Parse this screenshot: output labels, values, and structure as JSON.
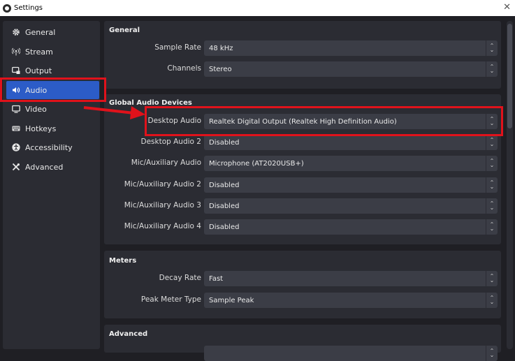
{
  "window": {
    "title": "Settings",
    "close_glyph": "✕"
  },
  "sidebar": {
    "items": [
      {
        "label": "General",
        "icon": "gear-icon"
      },
      {
        "label": "Stream",
        "icon": "broadcast-icon"
      },
      {
        "label": "Output",
        "icon": "output-icon"
      },
      {
        "label": "Audio",
        "icon": "speaker-icon",
        "active": true
      },
      {
        "label": "Video",
        "icon": "monitor-icon"
      },
      {
        "label": "Hotkeys",
        "icon": "keyboard-icon"
      },
      {
        "label": "Accessibility",
        "icon": "accessibility-icon"
      },
      {
        "label": "Advanced",
        "icon": "tools-icon"
      }
    ]
  },
  "general": {
    "title": "General",
    "sample_rate": {
      "label": "Sample Rate",
      "value": "48 kHz"
    },
    "channels": {
      "label": "Channels",
      "value": "Stereo"
    }
  },
  "global_audio": {
    "title": "Global Audio Devices",
    "rows": [
      {
        "label": "Desktop Audio",
        "value": "Realtek Digital Output (Realtek High Definition Audio)"
      },
      {
        "label": "Desktop Audio 2",
        "value": "Disabled"
      },
      {
        "label": "Mic/Auxiliary Audio",
        "value": "Microphone (AT2020USB+)"
      },
      {
        "label": "Mic/Auxiliary Audio 2",
        "value": "Disabled"
      },
      {
        "label": "Mic/Auxiliary Audio 3",
        "value": "Disabled"
      },
      {
        "label": "Mic/Auxiliary Audio 4",
        "value": "Disabled"
      }
    ]
  },
  "meters": {
    "title": "Meters",
    "decay_rate": {
      "label": "Decay Rate",
      "value": "Fast"
    },
    "peak_meter_type": {
      "label": "Peak Meter Type",
      "value": "Sample Peak"
    }
  },
  "advanced": {
    "title": "Advanced"
  },
  "colors": {
    "accent": "#2c5cc7",
    "highlight": "#e0121b",
    "panel": "#2b2c33",
    "field": "#3b3d46"
  }
}
